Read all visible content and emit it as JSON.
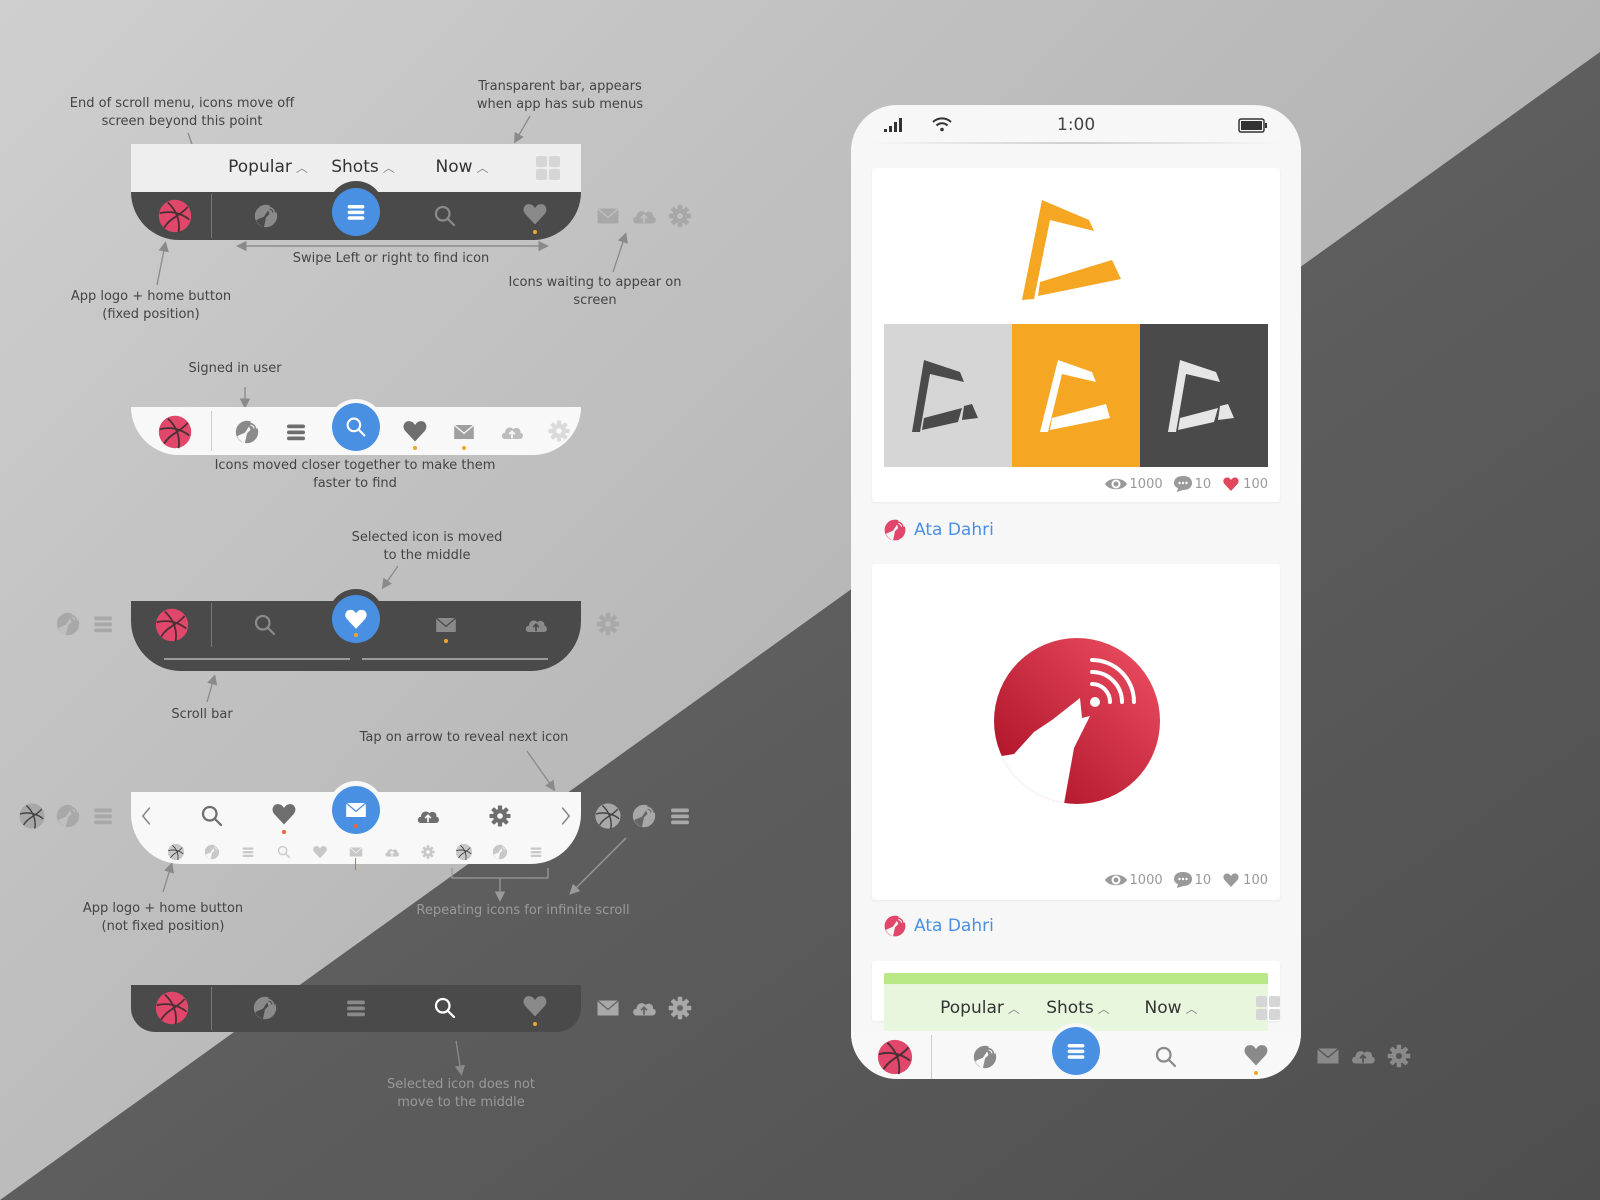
{
  "annotations": {
    "end_of_scroll": [
      "End of scroll menu, icons move off",
      "screen beyond this point"
    ],
    "transparent_bar": [
      "Transparent bar, appears",
      "when app has sub menus"
    ],
    "swipe": "Swipe Left or right to find icon",
    "app_logo_fixed": [
      "App logo + home button",
      "(fixed position)"
    ],
    "icons_waiting": [
      "Icons waiting to appear on",
      "screen"
    ],
    "signed_in": "Signed in user",
    "icons_closer": [
      "Icons moved closer together to make them",
      "faster to find"
    ],
    "selected_middle": [
      "Selected icon is moved",
      "to the middle"
    ],
    "scroll_bar": "Scroll bar",
    "tap_arrow": "Tap on arrow to reveal next icon",
    "app_logo_not_fixed": [
      "App logo + home button",
      "(not fixed position)"
    ],
    "repeating_icons": "Repeating icons for infinite scroll",
    "selected_not_middle": [
      "Selected icon does not",
      "move to the middle"
    ]
  },
  "submenu": {
    "tabs": [
      "Popular",
      "Shots",
      "Now"
    ],
    "caret": "^"
  },
  "nav_variants": [
    {
      "name": "dark-with-submenu",
      "selected": "menu",
      "icons": [
        "dribbble",
        "user",
        "menu",
        "search",
        "heart"
      ],
      "offscreen_right": [
        "mail",
        "cloud-upload",
        "gear"
      ]
    },
    {
      "name": "light-compact",
      "selected": "search",
      "icons": [
        "dribbble",
        "user",
        "menu",
        "search",
        "heart",
        "mail",
        "cloud-upload",
        "gear"
      ]
    },
    {
      "name": "dark-scrollbar",
      "selected": "heart",
      "icons": [
        "dribbble",
        "search",
        "heart",
        "mail",
        "cloud-upload"
      ],
      "offscreen_left": [
        "user",
        "menu"
      ],
      "offscreen_right": [
        "gear"
      ]
    },
    {
      "name": "light-arrows",
      "selected": "mail",
      "icons": [
        "chevron-left",
        "search",
        "heart",
        "mail",
        "cloud-upload",
        "gear",
        "chevron-right"
      ],
      "offscreen_left": [
        "dribbble",
        "user",
        "menu"
      ],
      "offscreen_right": [
        "dribbble",
        "user",
        "menu"
      ]
    },
    {
      "name": "dark-flat",
      "selected": "search",
      "icons": [
        "dribbble",
        "user",
        "menu",
        "search",
        "heart"
      ],
      "offscreen_right": [
        "mail",
        "cloud-upload",
        "gear"
      ]
    }
  ],
  "phone": {
    "status": {
      "time": "1:00",
      "signal": "signal-icon",
      "wifi": "wifi-icon",
      "battery": "battery-icon"
    },
    "posts": [
      {
        "views": "1000",
        "comments": "10",
        "likes": "100",
        "liked": true,
        "author": "Ata Dahri"
      },
      {
        "views": "1000",
        "comments": "10",
        "likes": "100",
        "liked": false,
        "author": "Ata Dahri"
      }
    ]
  },
  "colors": {
    "accent": "#4a90e2",
    "dribbble": "#e0476a",
    "notify_dot": "#f5a623",
    "logo_orange": "#f5a623",
    "dark_bar": "#4a4a4a",
    "like_red": "#e0475a",
    "green_strip": "#b8e986"
  }
}
